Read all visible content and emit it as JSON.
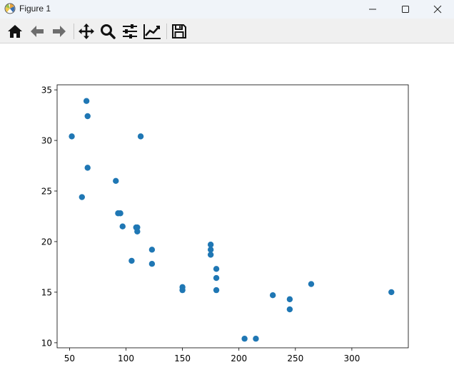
{
  "window": {
    "title": "Figure 1",
    "controls": [
      "minimize",
      "maximize",
      "close"
    ]
  },
  "toolbar": {
    "tools": [
      {
        "name": "home",
        "icon": "home-icon"
      },
      {
        "name": "back",
        "icon": "arrow-left-icon"
      },
      {
        "name": "forward",
        "icon": "arrow-right-icon"
      },
      {
        "name": "pan",
        "icon": "move-arrows-icon"
      },
      {
        "name": "zoom",
        "icon": "magnifier-icon"
      },
      {
        "name": "subplots",
        "icon": "sliders-icon"
      },
      {
        "name": "edit-axes",
        "icon": "line-chart-icon"
      },
      {
        "name": "save",
        "icon": "floppy-disk-icon"
      }
    ]
  },
  "chart_data": {
    "type": "scatter",
    "title": "",
    "xlabel": "",
    "ylabel": "",
    "xlim": [
      39,
      350
    ],
    "ylim": [
      9.5,
      35.5
    ],
    "xticks": [
      50,
      100,
      150,
      200,
      250,
      300
    ],
    "yticks": [
      10,
      15,
      20,
      25,
      30,
      35
    ],
    "grid": false,
    "marker_color": "#1f77b4",
    "points": [
      [
        52,
        30.4
      ],
      [
        61,
        24.4
      ],
      [
        65,
        33.9
      ],
      [
        66,
        32.4
      ],
      [
        66,
        27.3
      ],
      [
        91,
        26.0
      ],
      [
        93,
        22.8
      ],
      [
        95,
        22.8
      ],
      [
        97,
        21.5
      ],
      [
        105,
        18.1
      ],
      [
        109,
        21.4
      ],
      [
        110,
        21.4
      ],
      [
        110,
        21.0
      ],
      [
        113,
        30.4
      ],
      [
        123,
        19.2
      ],
      [
        123,
        17.8
      ],
      [
        150,
        15.5
      ],
      [
        150,
        15.2
      ],
      [
        175,
        19.7
      ],
      [
        175,
        19.2
      ],
      [
        175,
        18.7
      ],
      [
        180,
        17.3
      ],
      [
        180,
        16.4
      ],
      [
        180,
        15.2
      ],
      [
        205,
        10.4
      ],
      [
        215,
        10.4
      ],
      [
        230,
        14.7
      ],
      [
        245,
        14.3
      ],
      [
        245,
        13.3
      ],
      [
        264,
        15.8
      ],
      [
        335,
        15.0
      ]
    ]
  }
}
